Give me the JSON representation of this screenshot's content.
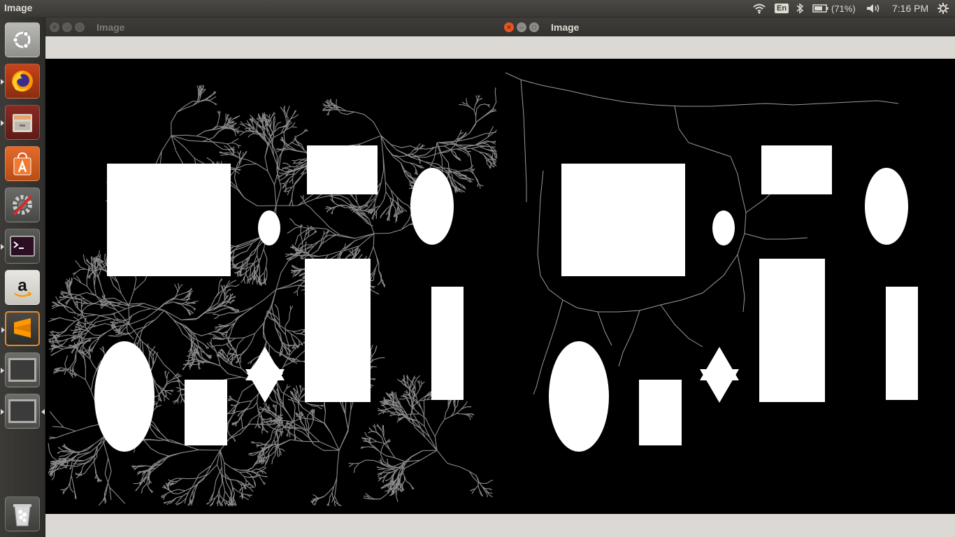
{
  "top_panel": {
    "app_title": "Image",
    "language": "En",
    "battery": "(71%)",
    "clock": "7:16 PM",
    "icons": [
      "wifi-icon",
      "bluetooth-icon",
      "battery-icon",
      "volume-icon",
      "gear-icon"
    ]
  },
  "launcher": {
    "items": [
      {
        "name": "ubuntu-dash",
        "icon": "ubuntu-logo-icon"
      },
      {
        "name": "firefox",
        "icon": "firefox-icon"
      },
      {
        "name": "files",
        "icon": "file-cabinet-icon"
      },
      {
        "name": "software-center",
        "icon": "shopping-bag-icon"
      },
      {
        "name": "system-settings",
        "icon": "wrench-gear-icon"
      },
      {
        "name": "terminal",
        "icon": "terminal-icon"
      },
      {
        "name": "amazon",
        "icon": "amazon-icon"
      },
      {
        "name": "sublime-text",
        "icon": "sublime-icon"
      },
      {
        "name": "image-window-1",
        "icon": "window-icon"
      },
      {
        "name": "image-window-2",
        "icon": "window-icon"
      },
      {
        "name": "trash",
        "icon": "trash-icon"
      }
    ]
  },
  "windows": [
    {
      "title": "Image",
      "active": false
    },
    {
      "title": "Image",
      "active": true
    }
  ],
  "colors": {
    "close_active": "#e95420",
    "panel_text": "#dfdbd2",
    "toolbar": "#dcd9d5",
    "tree_gray": "#8c8c8c"
  }
}
